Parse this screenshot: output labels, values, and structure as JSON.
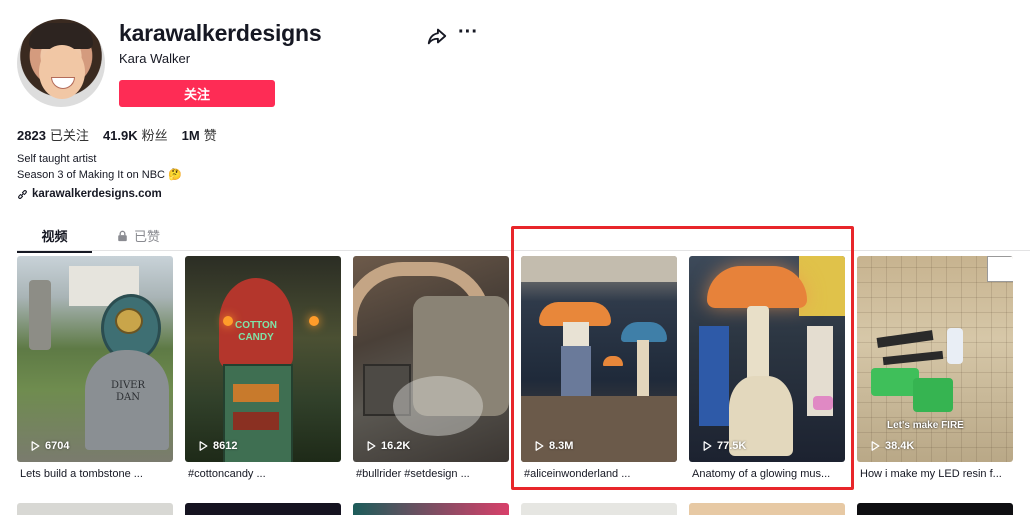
{
  "profile": {
    "username": "karawalkerdesigns",
    "nickname": "Kara Walker",
    "follow_label": "关注"
  },
  "stats": [
    {
      "value": "2823",
      "label": "已关注"
    },
    {
      "value": "41.9K",
      "label": "粉丝"
    },
    {
      "value": "1M",
      "label": "赞"
    }
  ],
  "bio": {
    "line1": "Self taught artist",
    "line2": "Season 3 of Making It on NBC",
    "line2_emoji": "🤔",
    "link": "karawalkerdesigns.com"
  },
  "tabs": {
    "videos": "视频",
    "liked": "已赞"
  },
  "videos": [
    {
      "views": "6704",
      "caption": "Lets build a tombstone ..."
    },
    {
      "views": "8612",
      "caption": "#cottoncandy ..."
    },
    {
      "views": "16.2K",
      "caption": "#bullrider #setdesign ..."
    },
    {
      "views": "8.3M",
      "caption": "#aliceinwonderland ..."
    },
    {
      "views": "77.5K",
      "caption": "Anatomy of a glowing mus..."
    },
    {
      "views": "38.4K",
      "caption": "How i make my LED resin f..."
    }
  ],
  "overlays": {
    "cotton_candy_sign": "COTTON CANDY",
    "tombstone_text": "DIVER DAN",
    "resin_overlay": "Let's make FIRE"
  },
  "colors": {
    "accent": "#fe2c55",
    "highlight_box": "#e8262a"
  }
}
